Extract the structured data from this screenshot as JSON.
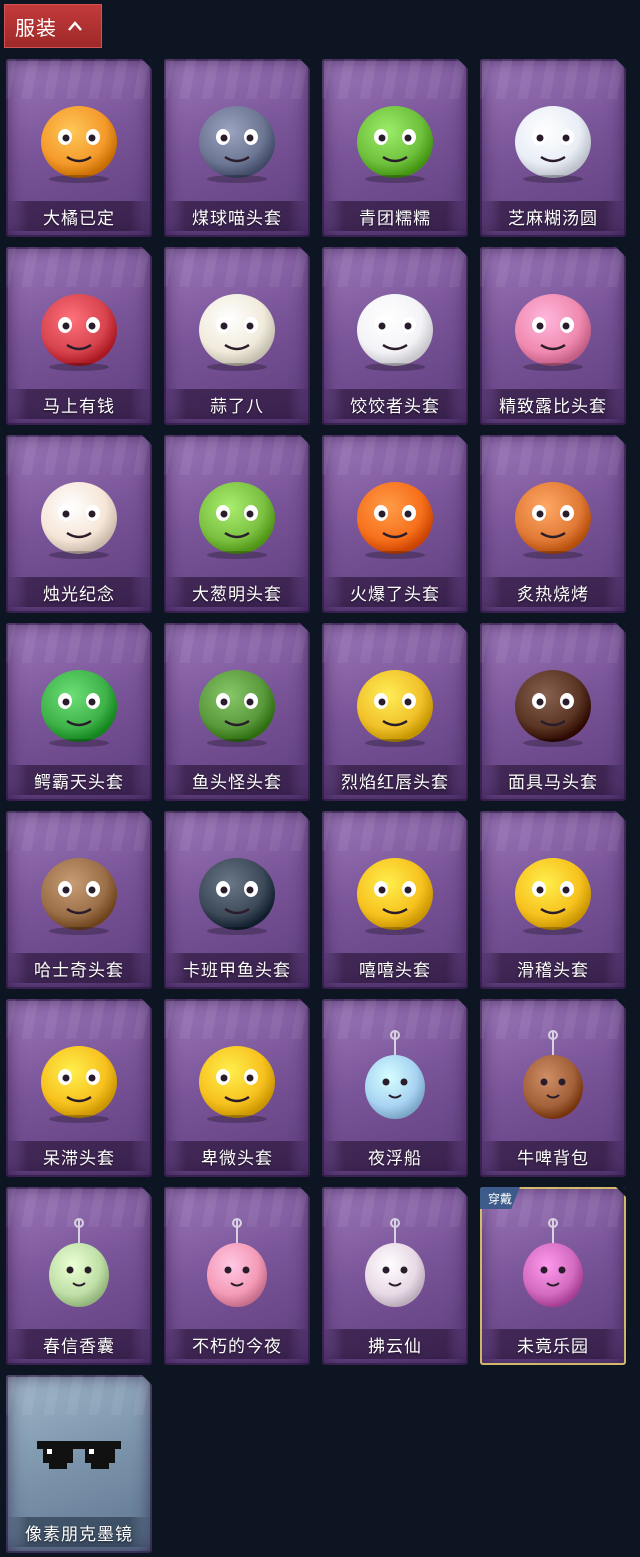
{
  "section": {
    "title": "服装",
    "toggle_icon": "chevron-up-icon"
  },
  "badge_equipped": "穿戴",
  "items": [
    {
      "name": "大橘已定",
      "icon": "orange-slice-mask",
      "color": "#f49a2b",
      "frame": "purple"
    },
    {
      "name": "煤球喵头套",
      "icon": "gray-cat-head",
      "color": "#6d7693",
      "frame": "purple"
    },
    {
      "name": "青团糯糯",
      "icon": "green-dumpling-head",
      "color": "#6fc13d",
      "frame": "purple"
    },
    {
      "name": "芝麻糊汤圆",
      "icon": "white-rice-ball-head",
      "color": "#e9eef6",
      "frame": "purple"
    },
    {
      "name": "马上有钱",
      "icon": "red-horse-head",
      "color": "#d7444e",
      "frame": "purple"
    },
    {
      "name": "蒜了八",
      "icon": "garlic-head",
      "color": "#f1ebdc",
      "frame": "purple"
    },
    {
      "name": "饺饺者头套",
      "icon": "dumpling-cloud-head",
      "color": "#f4f3f7",
      "frame": "purple"
    },
    {
      "name": "精致露比头套",
      "icon": "pink-beaver-head",
      "color": "#f08ab0",
      "frame": "purple"
    },
    {
      "name": "烛光纪念",
      "icon": "candle-head",
      "color": "#f6e6d8",
      "frame": "purple"
    },
    {
      "name": "大葱明头套",
      "icon": "green-onion-head",
      "color": "#7cc142",
      "frame": "purple"
    },
    {
      "name": "火爆了头套",
      "icon": "fireball-head",
      "color": "#f7701c",
      "frame": "purple"
    },
    {
      "name": "炙热烧烤",
      "icon": "bbq-meat-head",
      "color": "#e17b37",
      "frame": "purple"
    },
    {
      "name": "鳄霸天头套",
      "icon": "crocodile-head",
      "color": "#3fb24a",
      "frame": "purple"
    },
    {
      "name": "鱼头怪头套",
      "icon": "fish-monster-head",
      "color": "#5a9a3d",
      "frame": "purple"
    },
    {
      "name": "烈焰红唇头套",
      "icon": "yellow-sunglasses-head",
      "color": "#f1c12a",
      "frame": "purple"
    },
    {
      "name": "面具马头套",
      "icon": "brown-horse-mask",
      "color": "#5a3524",
      "frame": "purple"
    },
    {
      "name": "哈士奇头套",
      "icon": "dog-sunglasses-head",
      "color": "#9b7048",
      "frame": "purple"
    },
    {
      "name": "卡班甲鱼头套",
      "icon": "gray-fish-head",
      "color": "#3d4a5a",
      "frame": "purple"
    },
    {
      "name": "嘻嘻头套",
      "icon": "grinning-emoji-head",
      "color": "#f7c21f",
      "frame": "purple"
    },
    {
      "name": "滑稽头套",
      "icon": "smirk-emoji-head",
      "color": "#f7c21f",
      "frame": "purple"
    },
    {
      "name": "呆滞头套",
      "icon": "flushed-emoji-head",
      "color": "#f7c21f",
      "frame": "purple"
    },
    {
      "name": "卑微头套",
      "icon": "pleading-emoji-head",
      "color": "#f7c21f",
      "frame": "purple"
    },
    {
      "name": "夜浮船",
      "icon": "jellyfish-backpack",
      "color": "#a8d3f2",
      "frame": "purple"
    },
    {
      "name": "牛啤背包",
      "icon": "beer-cow-backpack",
      "color": "#a3613a",
      "frame": "purple"
    },
    {
      "name": "春信香囊",
      "icon": "sachet-pendant",
      "color": "#bfe0a7",
      "frame": "purple"
    },
    {
      "name": "不朽的今夜",
      "icon": "pink-fox-pendant",
      "color": "#f49bb7",
      "frame": "purple"
    },
    {
      "name": "拂云仙",
      "icon": "fairy-pendant",
      "color": "#e8d9e6",
      "frame": "purple"
    },
    {
      "name": "未竟乐园",
      "icon": "doll-pendant",
      "color": "#d36cc0",
      "frame": "purple",
      "equipped": true
    },
    {
      "name": "像素朋克墨镜",
      "icon": "pixel-sunglasses",
      "color": "#111111",
      "frame": "blue"
    }
  ]
}
